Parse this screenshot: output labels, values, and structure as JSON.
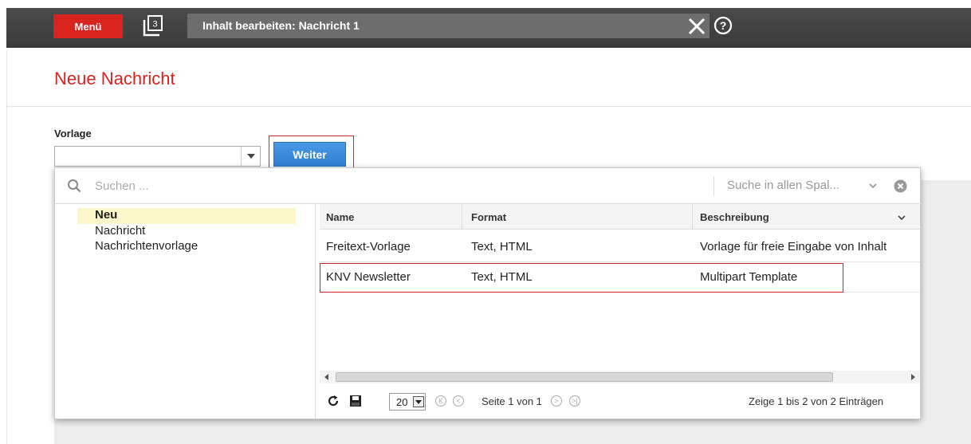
{
  "topbar": {
    "menu_label": "Menü",
    "window_count": "3",
    "title": "Inhalt bearbeiten: Nachricht 1"
  },
  "page": {
    "title": "Neue Nachricht",
    "vorlage_label": "Vorlage",
    "vorlage_value": "",
    "weiter_label": "Weiter"
  },
  "panel": {
    "search_placeholder": "Suchen ...",
    "scope_label": "Suche in allen Spal...",
    "tree": [
      {
        "label": "Neu",
        "selected": true
      },
      {
        "label": "Nachricht",
        "selected": false
      },
      {
        "label": "Nachrichtenvorlage",
        "selected": false
      }
    ],
    "columns": [
      "Name",
      "Format",
      "Beschreibung"
    ],
    "rows": [
      {
        "name": "Freitext-Vorlage",
        "format": "Text, HTML",
        "description": "Vorlage für freie Eingabe von Inhalt"
      },
      {
        "name": "KNV Newsletter",
        "format": "Text, HTML",
        "description": "Multipart Template"
      }
    ],
    "page_size": "20",
    "page_info": "Seite 1 von 1",
    "count_info": "Zeige 1 bis 2 von 2 Einträgen"
  },
  "colors": {
    "accent_red": "#d9231f",
    "button_blue": "#2f7fd3",
    "selection_yellow": "#fcf7c8"
  }
}
